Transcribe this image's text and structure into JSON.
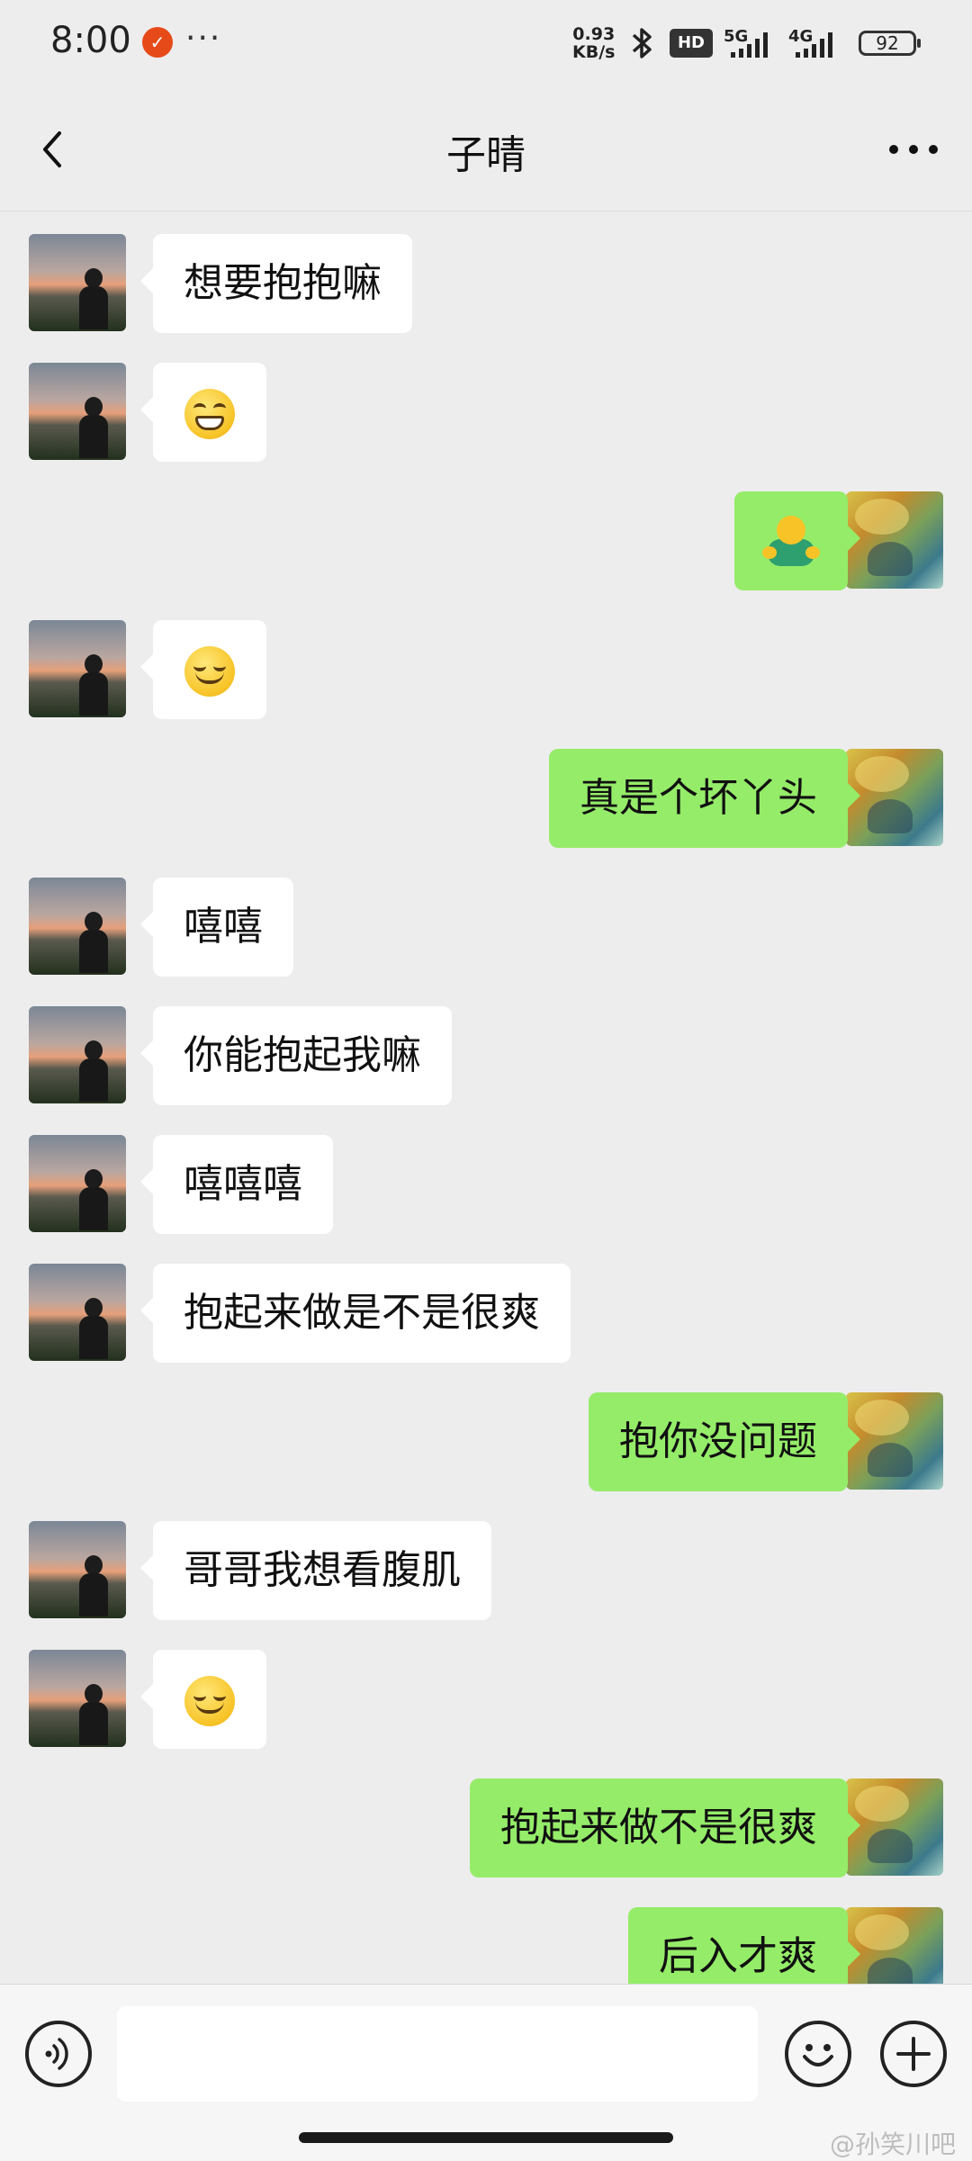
{
  "status_bar": {
    "time": "8:00",
    "more": "···",
    "net_speed_value": "0.93",
    "net_speed_unit": "KB/s",
    "hd_label": "HD",
    "signal_1_label": "5G",
    "signal_2_label": "4G",
    "battery": "92"
  },
  "header": {
    "title": "子晴"
  },
  "messages": [
    {
      "side": "left",
      "type": "text",
      "text": "想要抱抱嘛"
    },
    {
      "side": "left",
      "type": "emoji",
      "icon": "grin-emoji-icon"
    },
    {
      "side": "right",
      "type": "emoji",
      "icon": "hug-emoji-icon"
    },
    {
      "side": "left",
      "type": "emoji",
      "icon": "smirk-emoji-icon"
    },
    {
      "side": "right",
      "type": "text",
      "text": "真是个坏丫头"
    },
    {
      "side": "left",
      "type": "text",
      "text": "嘻嘻"
    },
    {
      "side": "left",
      "type": "text",
      "text": "你能抱起我嘛"
    },
    {
      "side": "left",
      "type": "text",
      "text": "嘻嘻嘻"
    },
    {
      "side": "left",
      "type": "text",
      "text": "抱起来做是不是很爽"
    },
    {
      "side": "right",
      "type": "text",
      "text": "抱你没问题"
    },
    {
      "side": "left",
      "type": "text",
      "text": "哥哥我想看腹肌"
    },
    {
      "side": "left",
      "type": "emoji",
      "icon": "smirk-emoji-icon"
    },
    {
      "side": "right",
      "type": "text",
      "text": "抱起来做不是很爽"
    },
    {
      "side": "right",
      "type": "text",
      "text": "后入才爽"
    }
  ],
  "input_bar": {
    "placeholder": "",
    "watermark": "@孙笑川吧"
  },
  "colors": {
    "background": "#ededed",
    "sent_bubble": "#95ec69",
    "received_bubble": "#ffffff"
  }
}
